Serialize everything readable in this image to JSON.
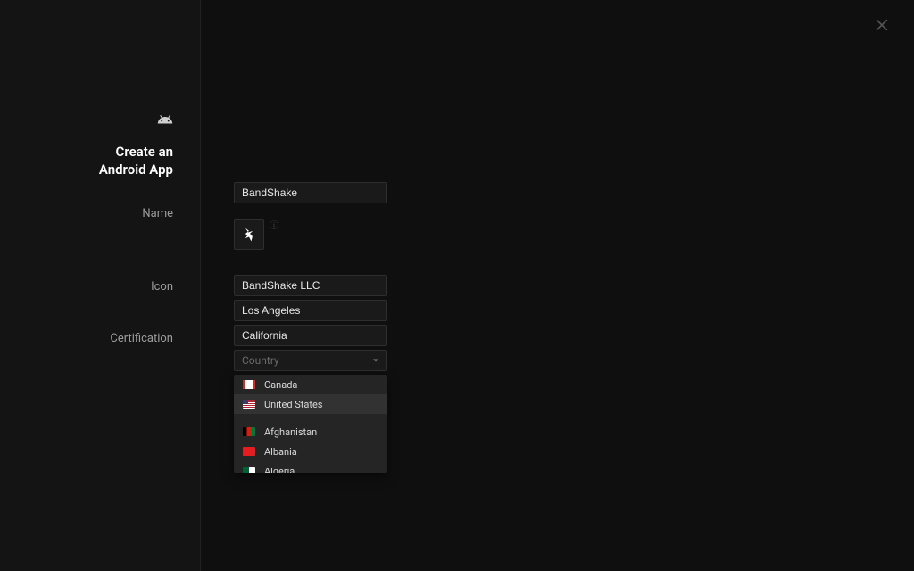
{
  "sidebar": {
    "title_line1": "Create an",
    "title_line2": "Android App",
    "labels": {
      "name": "Name",
      "icon": "Icon",
      "certification": "Certification"
    }
  },
  "form": {
    "name": "BandShake",
    "company": "BandShake LLC",
    "city": "Los Angeles",
    "state": "California",
    "country_placeholder": "Country"
  },
  "dropdown": {
    "items": [
      {
        "label": "Canada",
        "flag": "ca"
      },
      {
        "label": "United States",
        "flag": "us"
      },
      {
        "label": "Afghanistan",
        "flag": "af"
      },
      {
        "label": "Albania",
        "flag": "al"
      },
      {
        "label": "Algeria",
        "flag": "dz"
      }
    ],
    "highlighted": "United States"
  },
  "icons": {
    "android": "android-icon",
    "app": "app-icon",
    "info": "info-icon",
    "close": "close-icon",
    "chevron": "chevron-down-icon"
  }
}
